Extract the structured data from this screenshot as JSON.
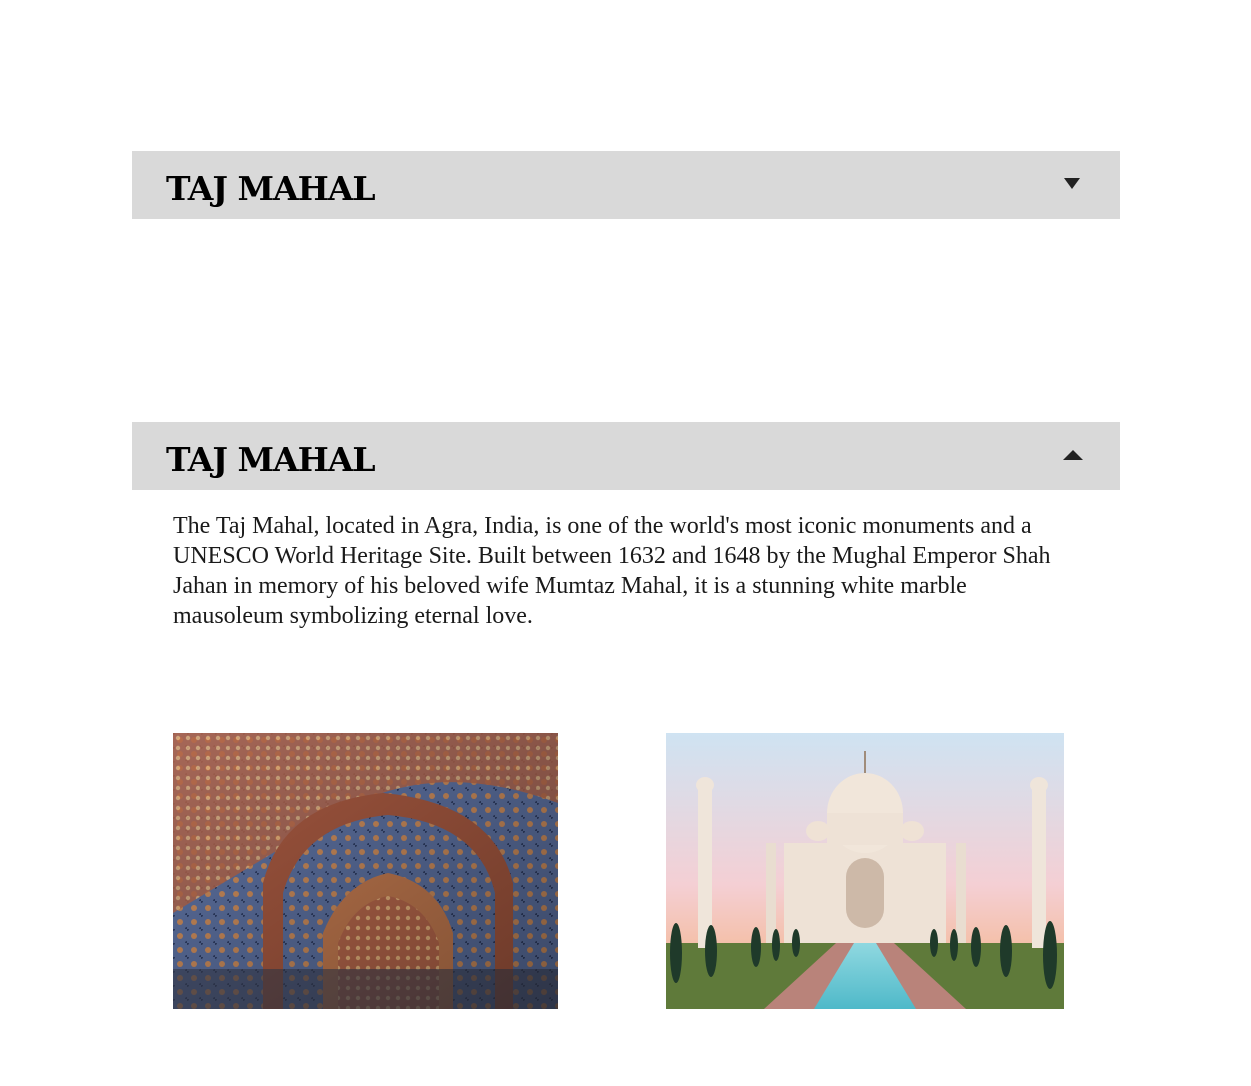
{
  "accordions": [
    {
      "title": "TAJ MAHAL",
      "state": "collapsed",
      "icon": "chevron-down-icon"
    },
    {
      "title": "TAJ MAHAL",
      "state": "expanded",
      "icon": "chevron-up-icon",
      "description": "The Taj Mahal, located in Agra, India, is one of the world's most iconic monuments and a UNESCO World Heritage Site. Built between 1632 and 1648 by the Mughal Emperor Shah Jahan in memory of his beloved wife Mumtaz Mahal, it is a stunning white marble mausoleum symbolizing eternal love."
    }
  ],
  "colors": {
    "header_bg": "#d9d9d9",
    "text": "#1a1a1a",
    "icon": "#222222"
  }
}
